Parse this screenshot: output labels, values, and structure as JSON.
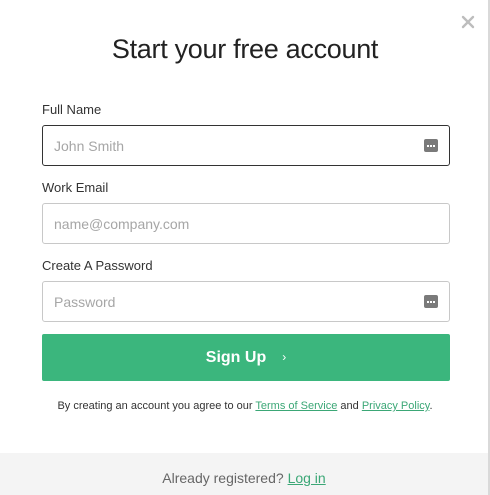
{
  "title": "Start your free account",
  "form": {
    "full_name": {
      "label": "Full Name",
      "placeholder": "John Smith",
      "value": ""
    },
    "work_email": {
      "label": "Work Email",
      "placeholder": "name@company.com",
      "value": ""
    },
    "password": {
      "label": "Create A Password",
      "placeholder": "Password",
      "value": ""
    }
  },
  "submit": {
    "label": "Sign Up",
    "chevron": "›"
  },
  "terms": {
    "prefix": "By creating an account you agree to our",
    "tos_link": "Terms of Service",
    "and": "and",
    "privacy_link": "Privacy Policy",
    "suffix": "."
  },
  "footer": {
    "prompt": "Already registered?",
    "login_link": "Log in"
  },
  "colors": {
    "accent": "#3bb67d",
    "link": "#3ba776",
    "title": "#222222",
    "footer_bg": "#f4f4f4"
  },
  "icons": {
    "close": "close-icon",
    "field_autofill": "autofill-dots-icon",
    "chevron": "chevron-right-icon"
  }
}
